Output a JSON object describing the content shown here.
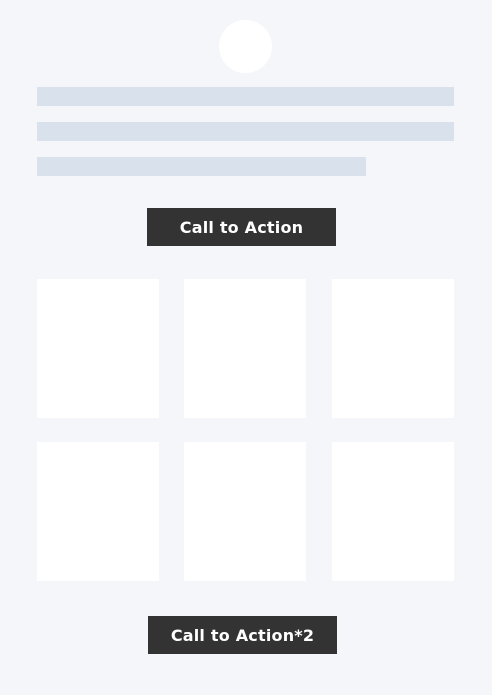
{
  "hero": {
    "cta_label": "Call to Action"
  },
  "footer": {
    "cta_label": "Call to Action*2"
  }
}
